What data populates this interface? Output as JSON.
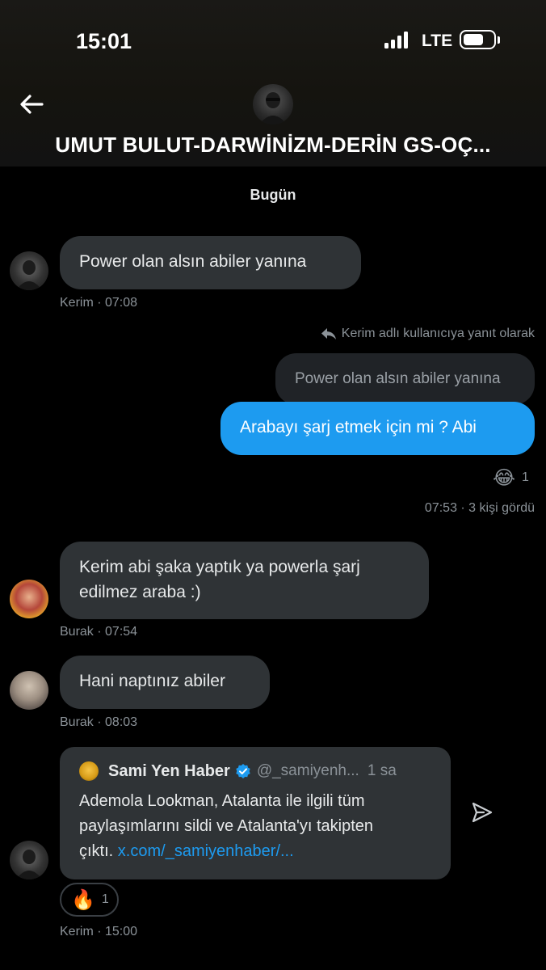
{
  "status_bar": {
    "time": "15:01",
    "network": "LTE"
  },
  "header": {
    "title": "UMUT BULUT-DARWİNİZM-DERİN GS-OÇ..."
  },
  "date_separator": "Bugün",
  "messages": [
    {
      "text": "Power olan alsın abiler yanına",
      "meta": "Kerim · 07:08"
    },
    {
      "reply_note": "Kerim adlı kullanıcıya yanıt olarak",
      "quoted": "Power olan alsın abiler yanına",
      "text": "Arabayı şarj etmek için mi ? Abi",
      "reaction_emoji": "😂",
      "reaction_count": "1",
      "meta": "07:53 · 3 kişi gördü"
    },
    {
      "text_line1": "Kerim abi şaka yaptık ya powerla şarj",
      "text_line2": "edilmez araba :)",
      "meta": "Burak · 07:54"
    },
    {
      "text": "Hani naptınız abiler",
      "meta": "Burak · 08:03"
    },
    {
      "card": {
        "name": "Sami Yen Haber",
        "handle": "@_samiyenh...",
        "time": "1 sa",
        "line1": "Ademola Lookman, Atalanta ile ilgili tüm",
        "line2": "paylaşımlarını sildi ve Atalanta'yı takipten",
        "line3": "çıktı.",
        "link": "x.com/_samiyenhaber/..."
      },
      "reaction_emoji": "🔥",
      "reaction_count": "1",
      "meta": "Kerim · 15:00"
    }
  ],
  "colors": {
    "accent": "#1d9bf0",
    "bubble_incoming": "#2f3336",
    "background": "#000000"
  },
  "icons": [
    "back-arrow-icon",
    "reply-arrow-icon",
    "verified-badge-icon",
    "send-icon",
    "battery-icon",
    "signal-icon"
  ]
}
